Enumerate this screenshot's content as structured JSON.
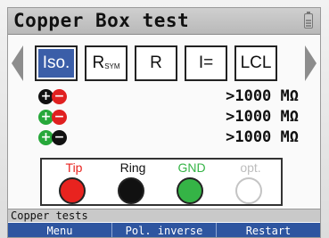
{
  "title": "Copper Box test",
  "tabs": [
    {
      "label": "Iso.",
      "sub": "",
      "active": true
    },
    {
      "label": "R",
      "sub": "SYM",
      "active": false
    },
    {
      "label": "R",
      "sub": "",
      "active": false
    },
    {
      "label": "I=",
      "sub": "",
      "active": false
    },
    {
      "label": "LCL",
      "sub": "",
      "active": false
    }
  ],
  "measurements": [
    {
      "left_color": "#111111",
      "left_sign": "+",
      "right_color": "#e02020",
      "right_sign": "−",
      "value": ">1000 MΩ"
    },
    {
      "left_color": "#27a83a",
      "left_sign": "+",
      "right_color": "#e02020",
      "right_sign": "−",
      "value": ">1000 MΩ"
    },
    {
      "left_color": "#27a83a",
      "left_sign": "+",
      "right_color": "#111111",
      "right_sign": "−",
      "value": ">1000 MΩ"
    }
  ],
  "terminals": [
    {
      "label": "Tip",
      "color": "#e8231f",
      "label_color": "#e8231f"
    },
    {
      "label": "Ring",
      "color": "#111111",
      "label_color": "#111111"
    },
    {
      "label": "GND",
      "color": "#35b446",
      "label_color": "#35b446"
    },
    {
      "label": "opt.",
      "color": "#ffffff",
      "label_color": "#bdbdbd"
    }
  ],
  "status": "Copper tests",
  "softkeys": [
    "Menu",
    "Pol. inverse",
    "Restart"
  ]
}
